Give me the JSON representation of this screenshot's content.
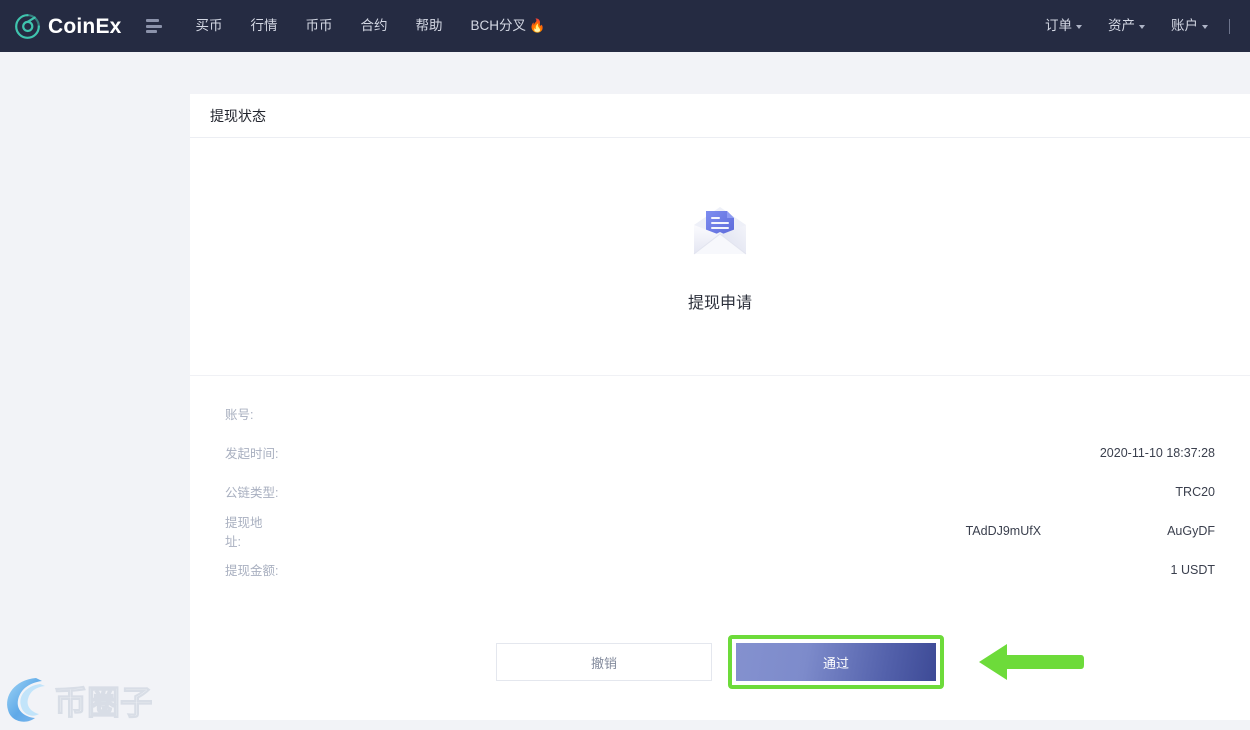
{
  "header": {
    "brand": "CoinEx",
    "brand_icon": "coinex-logo-icon",
    "menu_icon": "list-menu-icon",
    "nav_left": [
      {
        "label": "买币"
      },
      {
        "label": "行情"
      },
      {
        "label": "币币"
      },
      {
        "label": "合约"
      },
      {
        "label": "帮助"
      },
      {
        "label": "BCH分叉",
        "emoji": "🔥"
      }
    ],
    "nav_right": [
      {
        "label": "订单"
      },
      {
        "label": "资产"
      },
      {
        "label": "账户"
      }
    ]
  },
  "card": {
    "title": "提现状态",
    "hero": {
      "icon": "open-envelope-document-icon",
      "title": "提现申请"
    },
    "details": [
      {
        "label": "账号:",
        "value": ""
      },
      {
        "label": "发起时间:",
        "value": "2020-11-10 18:37:28"
      },
      {
        "label": "公链类型:",
        "value": "TRC20"
      },
      {
        "label": "提现地址:",
        "value_prefix": "TAdDJ9mUfX",
        "value_suffix": "AuGyDF",
        "masked": true
      },
      {
        "label": "提现金额:",
        "value": "1 USDT"
      }
    ],
    "actions": {
      "cancel_label": "撤销",
      "pass_label": "通过",
      "highlight_color": "#6ddb3a",
      "arrow_icon": "left-arrow-annotation-icon"
    }
  },
  "watermark": {
    "text": "币圈子",
    "icon": "bi-quan-zi-swirl-logo"
  },
  "colors": {
    "topbar_bg": "#252b42",
    "page_bg": "#f2f3f7",
    "card_bg": "#ffffff",
    "brand_accent": "#3fc4ae",
    "pass_button_from": "#8491cf",
    "pass_button_to": "#3d4a96",
    "label_text": "#a9b0c0",
    "value_text": "#3a3f4d"
  }
}
